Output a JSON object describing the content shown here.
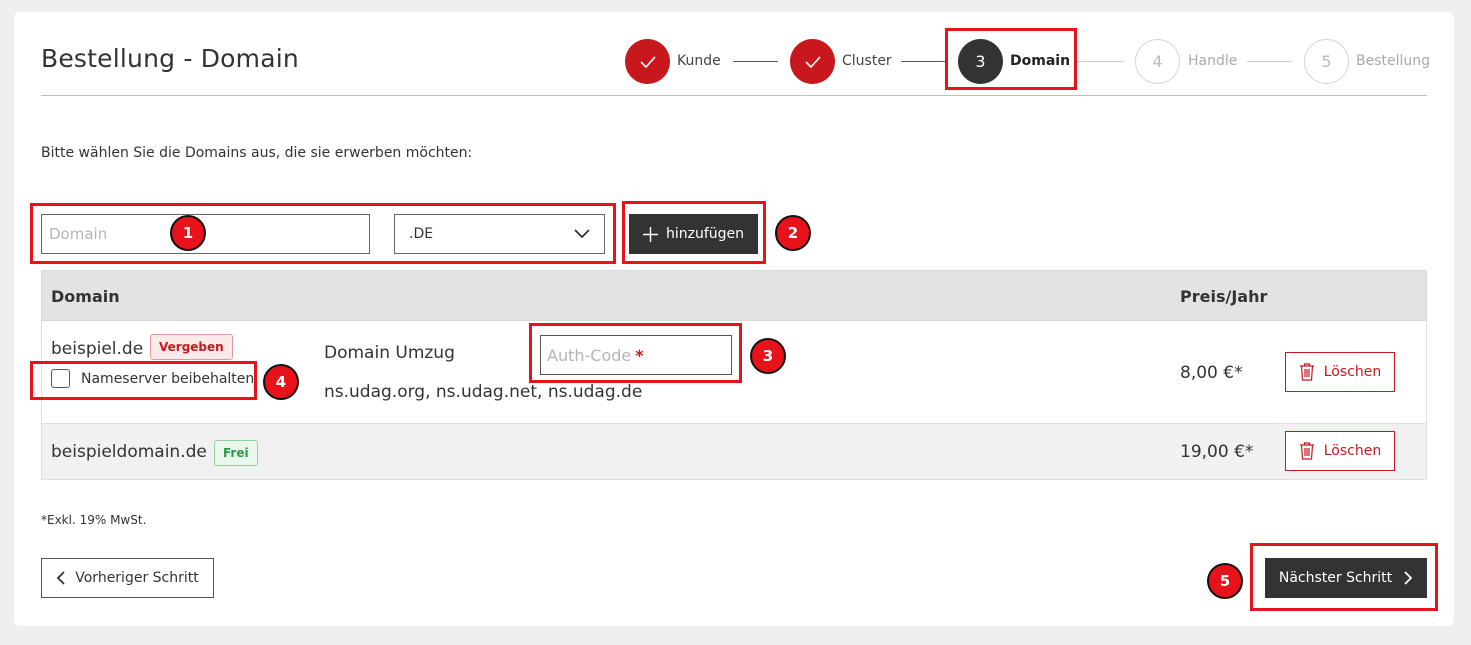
{
  "page": {
    "title": "Bestellung - Domain"
  },
  "stepper": {
    "steps": [
      {
        "num": "",
        "label": "Kunde",
        "state": "done"
      },
      {
        "num": "",
        "label": "Cluster",
        "state": "done"
      },
      {
        "num": "3",
        "label": "Domain",
        "state": "active"
      },
      {
        "num": "4",
        "label": "Handle",
        "state": "todo"
      },
      {
        "num": "5",
        "label": "Bestellung",
        "state": "todo"
      }
    ]
  },
  "intro": "Bitte wählen Sie die Domains aus, die sie erwerben möchten:",
  "form": {
    "domain_placeholder": "Domain",
    "tld_value": ".DE",
    "add_label": "hinzufügen"
  },
  "table": {
    "headers": {
      "domain": "Domain",
      "price": "Preis/Jahr"
    },
    "rows": [
      {
        "domain": "beispiel.de",
        "status": "Vergeben",
        "checkbox_label": "Nameserver beibehalten",
        "action": "Domain Umzug",
        "nameservers": "ns.udag.org, ns.udag.net, ns.udag.de",
        "auth_placeholder": "Auth-Code",
        "auth_required": "*",
        "price": "8,00 €*",
        "delete_label": "Löschen"
      },
      {
        "domain": "beispieldomain.de",
        "status": "Frei",
        "price": "19,00 €*",
        "delete_label": "Löschen"
      }
    ]
  },
  "footnote": "*Exkl. 19% MwSt.",
  "nav": {
    "prev_label": "Vorheriger Schritt",
    "next_label": "Nächster Schritt"
  },
  "annotations": [
    "1",
    "2",
    "3",
    "4",
    "5"
  ],
  "colors": {
    "brand_red": "#c8171d",
    "dark": "#333333",
    "highlight": "#e8121a"
  }
}
